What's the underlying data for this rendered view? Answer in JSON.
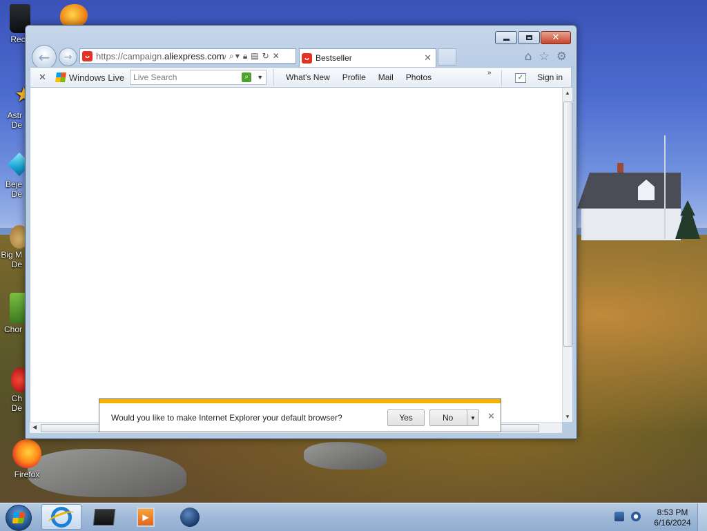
{
  "desktop": {
    "icons": [
      {
        "label": "Recy"
      },
      {
        "label": "Astr\nDe"
      },
      {
        "label": "Beje\nDe"
      },
      {
        "label": "Big M\nDe"
      },
      {
        "label": "Chor"
      },
      {
        "label": "Ch\nDe"
      },
      {
        "label": "Firefox"
      }
    ]
  },
  "browser": {
    "address": {
      "url_prefix": "https://campaign.",
      "url_domain": "aliexpress.com",
      "url_suffix": "/w"
    },
    "tab": {
      "title": "Bestseller"
    },
    "command_bar": {
      "windows_live": "Windows Live",
      "search_placeholder": "Live Search",
      "links": [
        "What's New",
        "Profile",
        "Mail",
        "Photos"
      ],
      "more": "»",
      "sign_in": "Sign in"
    }
  },
  "notification": {
    "message": "Would you like to make Internet Explorer your default browser?",
    "yes": "Yes",
    "no": "No"
  },
  "taskbar": {
    "time": "8:53 PM",
    "date": "6/16/2024"
  },
  "colors": {
    "accent": "#f0b400",
    "close_button": "#c6452a",
    "favicon": "#e43225"
  }
}
